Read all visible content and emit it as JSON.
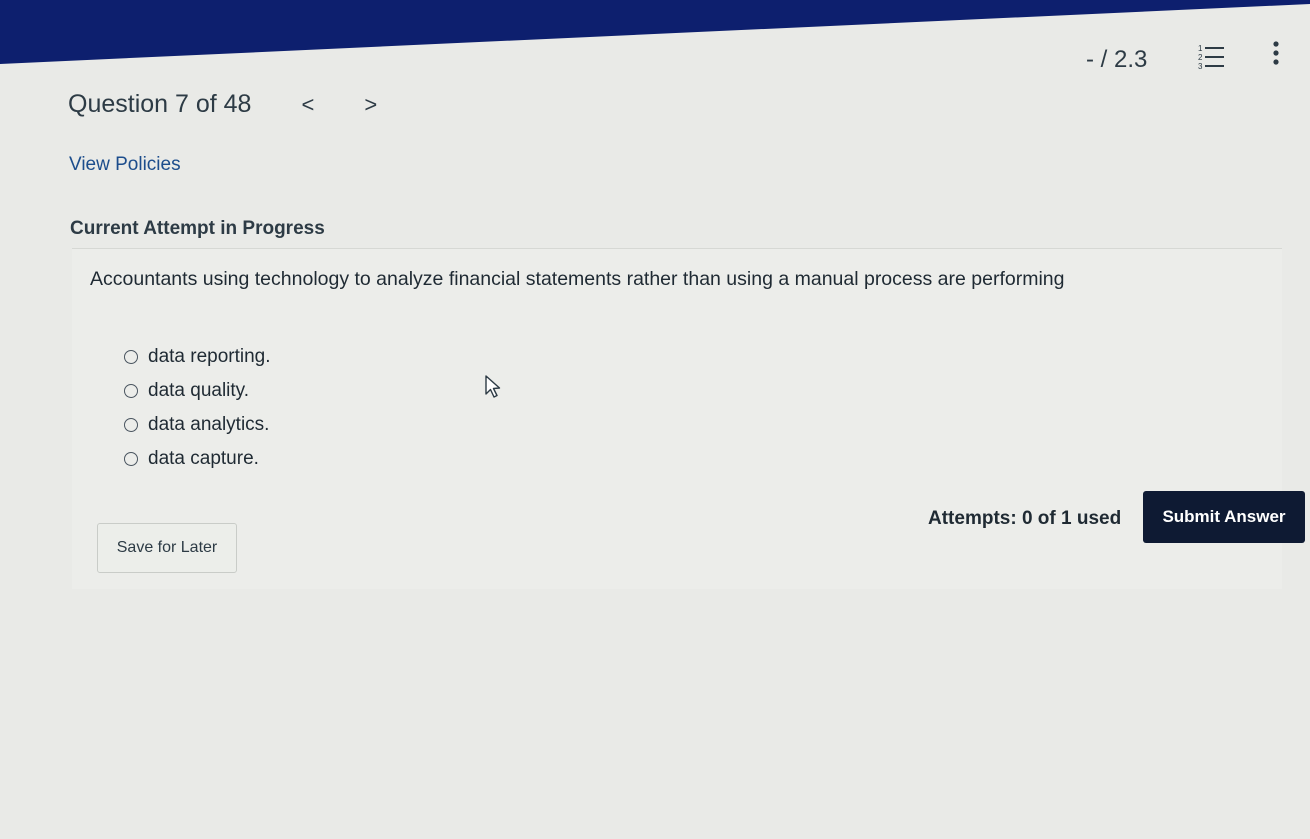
{
  "header": {
    "score": "- / 2.3",
    "list_icon": "numbered-list-icon",
    "more_icon": "vertical-ellipsis-icon"
  },
  "question": {
    "title": "Question 7 of 48",
    "prev_label": "<",
    "next_label": ">",
    "policies_link": "View Policies",
    "attempt_status": "Current Attempt in Progress",
    "text": "Accountants using technology to analyze financial statements rather than using a manual process are performing",
    "options": [
      {
        "label": "data reporting."
      },
      {
        "label": "data quality."
      },
      {
        "label": "data analytics."
      },
      {
        "label": "data capture."
      }
    ]
  },
  "footer": {
    "save_label": "Save for Later",
    "attempts_text": "Attempts: 0 of 1 used",
    "submit_label": "Submit Answer"
  },
  "colors": {
    "topbar": "#0d1f6e",
    "submit_bg": "#0e1a33",
    "link": "#1c4d8c"
  }
}
